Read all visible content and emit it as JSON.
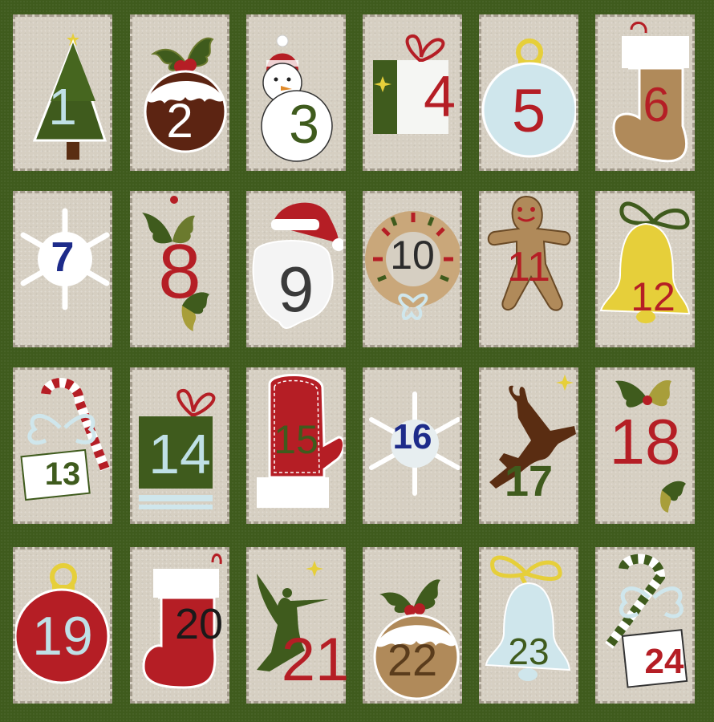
{
  "calendar": {
    "days": [
      {
        "number": "1",
        "item": "christmas-tree",
        "color": "#bfe0e6"
      },
      {
        "number": "2",
        "item": "christmas-pudding",
        "color": "#ffffff"
      },
      {
        "number": "3",
        "item": "snowman",
        "color": "#3f5b1d"
      },
      {
        "number": "4",
        "item": "gift-box",
        "color": "#b51e25"
      },
      {
        "number": "5",
        "item": "bauble",
        "color": "#b51e25"
      },
      {
        "number": "6",
        "item": "stocking",
        "color": "#b51e25"
      },
      {
        "number": "7",
        "item": "snowflake",
        "color": "#1d2b8a"
      },
      {
        "number": "8",
        "item": "holly",
        "color": "#b51e25"
      },
      {
        "number": "9",
        "item": "santa",
        "color": "#3a3a3a"
      },
      {
        "number": "10",
        "item": "wreath",
        "color": "#2b2b2b"
      },
      {
        "number": "11",
        "item": "gingerbread-man",
        "color": "#b51e25"
      },
      {
        "number": "12",
        "item": "bell",
        "color": "#b51e25"
      },
      {
        "number": "13",
        "item": "candy-cane",
        "color": "#3f5b1d"
      },
      {
        "number": "14",
        "item": "gift-box",
        "color": "#bfe0e6"
      },
      {
        "number": "15",
        "item": "mitten",
        "color": "#3f5b1d"
      },
      {
        "number": "16",
        "item": "snowflake",
        "color": "#1d2b8a"
      },
      {
        "number": "17",
        "item": "reindeer",
        "color": "#3f5b1d"
      },
      {
        "number": "18",
        "item": "holly",
        "color": "#b51e25"
      },
      {
        "number": "19",
        "item": "bauble",
        "color": "#bfe0e6"
      },
      {
        "number": "20",
        "item": "stocking",
        "color": "#1a1a1a"
      },
      {
        "number": "21",
        "item": "angel",
        "color": "#b51e25"
      },
      {
        "number": "22",
        "item": "christmas-pudding",
        "color": "#5a3c1c"
      },
      {
        "number": "23",
        "item": "bell",
        "color": "#3f5b1d"
      },
      {
        "number": "24",
        "item": "candy-cane",
        "color": "#b51e25"
      }
    ]
  },
  "colors": {
    "background": "#3f5b1d",
    "tile": "#d6cfc2",
    "red": "#b51e25",
    "green": "#3f5b1d",
    "gold": "#e6cf3a",
    "ice": "#cfe6ec",
    "brown": "#b08a5a",
    "navy": "#1d2b8a"
  }
}
